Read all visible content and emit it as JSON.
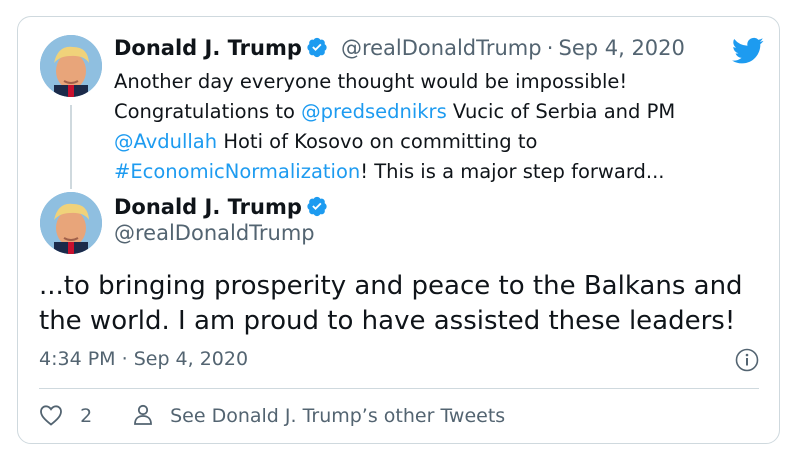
{
  "first_tweet": {
    "author_name": "Donald J. Trump",
    "handle": "@realDonaldTrump",
    "separator": "·",
    "date": "Sep 4, 2020",
    "text_parts": [
      {
        "text": "Another day everyone thought would be impossible!",
        "kind": "plain"
      },
      {
        "text": "Congratulations to ",
        "kind": "plain"
      },
      {
        "text": "@predsednikrs",
        "kind": "link"
      },
      {
        "text": " Vucic of Serbia and PM",
        "kind": "plain"
      },
      {
        "text": "@Avdullah",
        "kind": "link"
      },
      {
        "text": " Hoti of Kosovo on committing to",
        "kind": "plain"
      },
      {
        "text": "#EconomicNormalization",
        "kind": "link"
      },
      {
        "text": "! This is a major step forward...",
        "kind": "plain"
      }
    ]
  },
  "main_tweet": {
    "author_name": "Donald J. Trump",
    "handle": "@realDonaldTrump",
    "text_line1": "...to bringing prosperity and peace to the Balkans and",
    "text_line2": "the world. I am proud to have assisted these leaders!",
    "time": "4:34 PM",
    "separator": "·",
    "date": "Sep 4, 2020"
  },
  "actions": {
    "like_count": "2",
    "see_more_label": "See Donald J. Trump’s other Tweets"
  },
  "icons": {
    "brand": "twitter-bird-icon",
    "verified": "verified-badge-icon",
    "info": "info-icon",
    "like": "heart-icon",
    "profile": "person-icon"
  },
  "colors": {
    "link": "#1d9bf0",
    "secondary_text": "#536471",
    "border": "#cfd9de",
    "brand": "#1d9bf0"
  }
}
